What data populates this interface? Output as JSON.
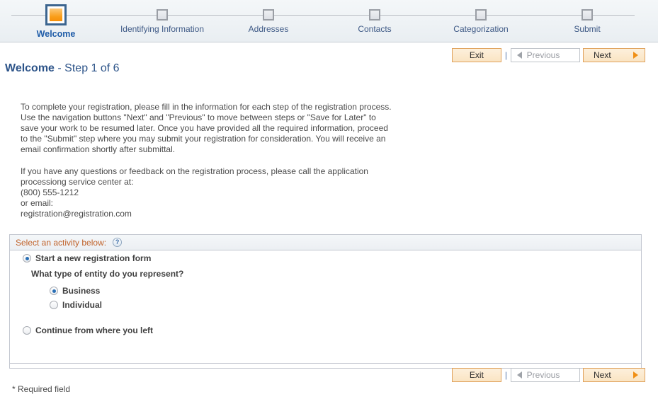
{
  "wizard": {
    "steps": [
      {
        "label": "Welcome",
        "active": true
      },
      {
        "label": "Identifying Information",
        "active": false
      },
      {
        "label": "Addresses",
        "active": false
      },
      {
        "label": "Contacts",
        "active": false
      },
      {
        "label": "Categorization",
        "active": false
      },
      {
        "label": "Submit",
        "active": false
      }
    ]
  },
  "toolbar": {
    "exit_label": "Exit",
    "previous_label": "Previous",
    "next_label": "Next",
    "separator": "|",
    "previous_icon": "triangle-left-icon",
    "next_icon": "triangle-right-icon",
    "previous_disabled": true
  },
  "title": {
    "main": "Welcome",
    "suffix": " - Step 1 of 6"
  },
  "intro": {
    "paragraph1": "To complete your registration, please fill in the information for each step of the registration process.  Use the navigation buttons \"Next\" and \"Previous\" to move between steps or \"Save for Later\" to save your work to be resumed later.  Once you have provided all the required information, proceed to the \"Submit\" step where you may submit your registration for consideration.  You will receive an email confirmation shortly after submittal.",
    "paragraph2": "If you have any questions or feedback on the registration process, please call the application processiong service center at:",
    "phone": "(800) 555-1212",
    "or_email": "or email:",
    "email": "registration@registration.com"
  },
  "activity": {
    "header_label": "Select an activity below:",
    "help_icon": "question-mark-icon",
    "help_glyph": "?",
    "options": [
      {
        "label": "Start a new registration form",
        "selected": true
      },
      {
        "label": "Continue from where you left",
        "selected": false
      }
    ],
    "entity_question": "What type of entity do you represent?",
    "entity_options": [
      {
        "label": "Business",
        "selected": true
      },
      {
        "label": "Individual",
        "selected": false
      }
    ]
  },
  "footer": {
    "required_note": "* Required field"
  },
  "colors": {
    "accent_orange": "#f79009",
    "active_step_border": "#3c658f",
    "title_blue": "#2d5489",
    "header_text_orange": "#c0622a",
    "radio_dot_blue": "#2a6fb5",
    "panel_border": "#c3c7d0"
  }
}
